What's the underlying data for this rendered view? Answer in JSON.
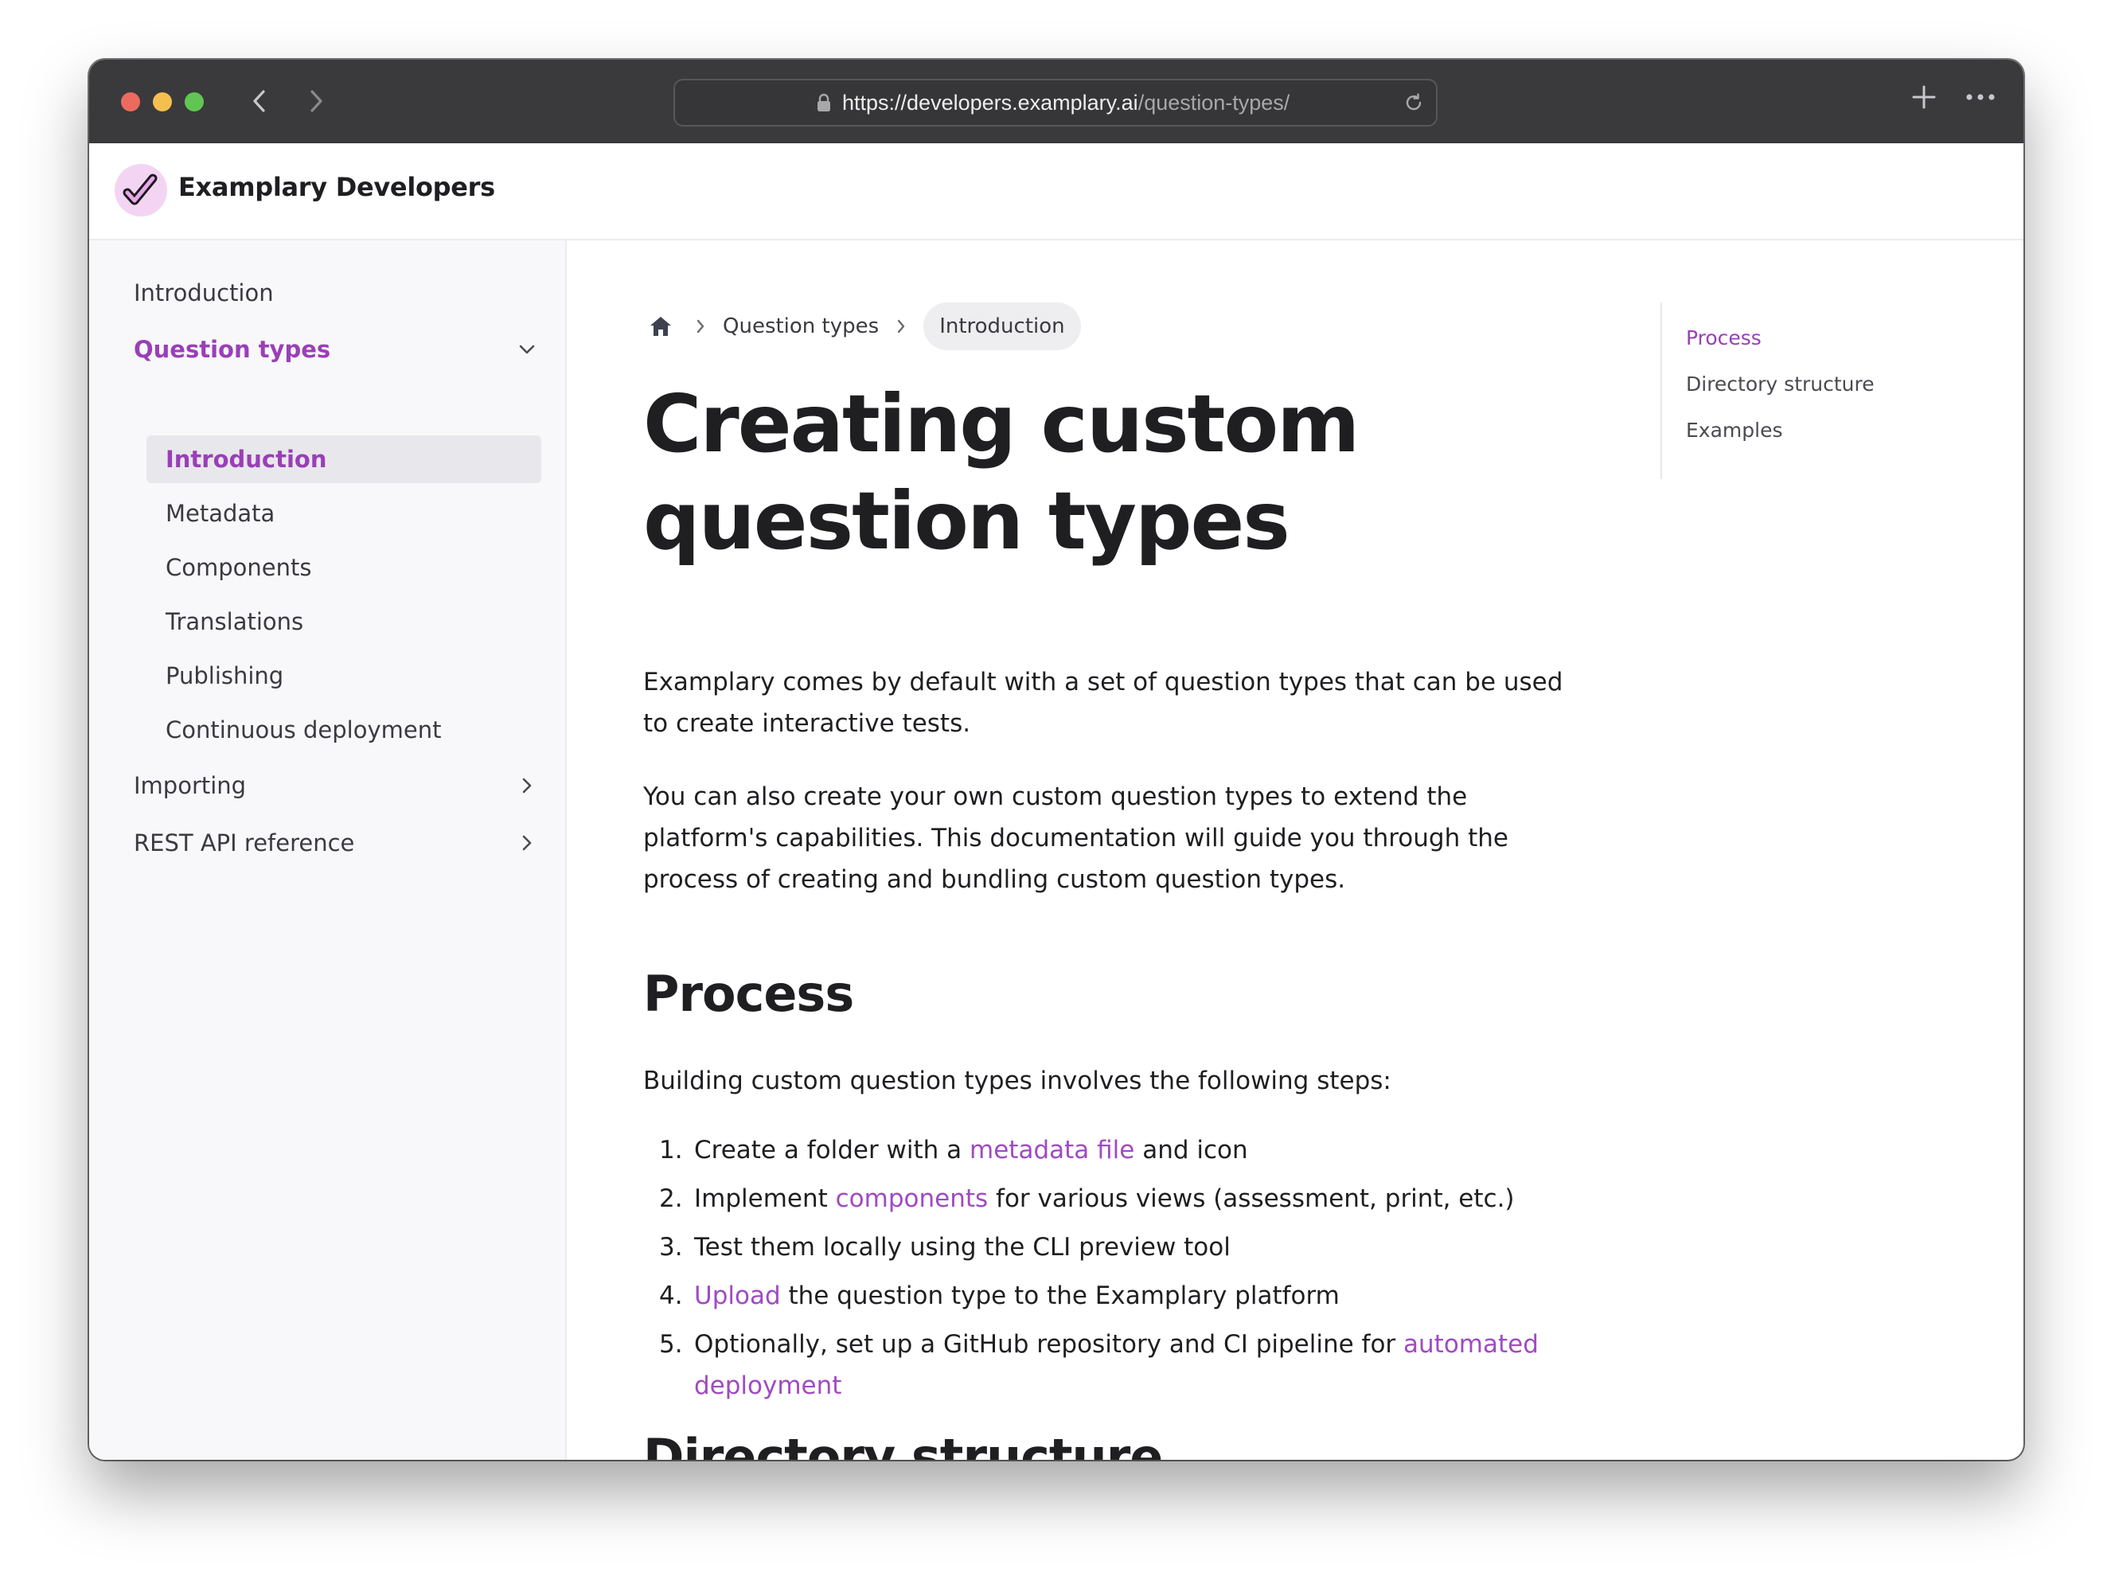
{
  "browser": {
    "url_host": "https://developers.examplary.ai",
    "url_path": "/question-types/"
  },
  "site": {
    "title": "Examplary Developers",
    "accent_color": "#9a3fb7"
  },
  "sidebar": {
    "items": [
      {
        "label": "Introduction"
      },
      {
        "label": "Question types",
        "expanded": true
      },
      {
        "label": "Importing"
      },
      {
        "label": "REST API reference"
      }
    ],
    "subitems": [
      {
        "label": "Introduction",
        "active": true
      },
      {
        "label": "Metadata"
      },
      {
        "label": "Components"
      },
      {
        "label": "Translations"
      },
      {
        "label": "Publishing"
      },
      {
        "label": "Continuous deployment"
      }
    ]
  },
  "breadcrumb": {
    "home_icon": "home-icon",
    "items": [
      "Question types",
      "Introduction"
    ]
  },
  "content": {
    "title": "Creating custom question types",
    "intro_1": "Examplary comes by default with a set of question types that can be used to create interactive tests.",
    "intro_2": "You can also create your own custom question types to extend the platform's capabilities. This documentation will guide you through the process of creating and bundling custom question types.",
    "process_heading": "Process",
    "process_intro": "Building custom question types involves the following steps:",
    "steps": [
      {
        "num": "1.",
        "pre": "Create a folder with a ",
        "link": "metadata file",
        "post": " and icon"
      },
      {
        "num": "2.",
        "pre": "Implement ",
        "link": "components",
        "post": " for various views (assessment, print, etc.)"
      },
      {
        "num": "3.",
        "pre": "Test them locally using the CLI preview tool",
        "link": "",
        "post": ""
      },
      {
        "num": "4.",
        "pre": "",
        "link": "Upload",
        "post": " the question type to the Examplary platform"
      },
      {
        "num": "5.",
        "pre": "Optionally, set up a GitHub repository and CI pipeline for ",
        "link": "automated deployment",
        "post": ""
      }
    ],
    "directory_heading": "Directory structure"
  },
  "toc": {
    "items": [
      "Process",
      "Directory structure",
      "Examples"
    ]
  }
}
